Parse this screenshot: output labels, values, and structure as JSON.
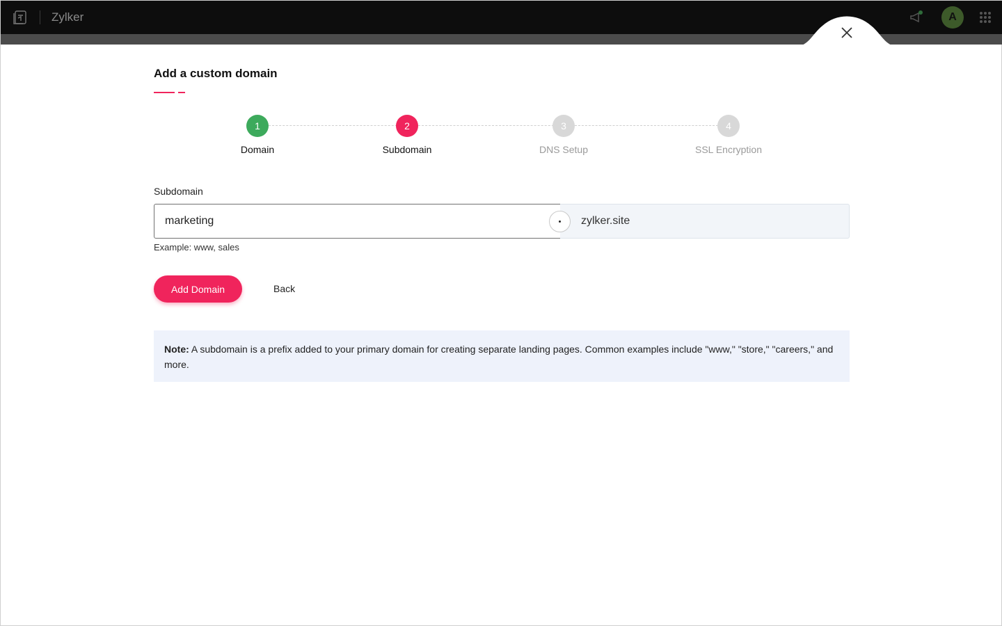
{
  "topbar": {
    "app_name": "Zylker",
    "avatar_initial": "A",
    "icons": [
      "app-logo-icon",
      "megaphone-icon",
      "apps-grid-icon"
    ]
  },
  "panel": {
    "title": "Add a custom domain",
    "close_icon": "close-icon"
  },
  "stepper": {
    "steps": [
      {
        "number": "1",
        "label": "Domain",
        "state": "completed"
      },
      {
        "number": "2",
        "label": "Subdomain",
        "state": "active"
      },
      {
        "number": "3",
        "label": "DNS Setup",
        "state": "pending"
      },
      {
        "number": "4",
        "label": "SSL Encryption",
        "state": "pending"
      }
    ]
  },
  "form": {
    "label": "Subdomain",
    "value": "marketing",
    "suffix": "zylker.site",
    "hint": "Example: www, sales"
  },
  "actions": {
    "primary_label": "Add Domain",
    "back_label": "Back"
  },
  "note": {
    "prefix": "Note:",
    "text": " A subdomain is a prefix added to your primary domain for creating separate landing pages. Common examples include \"www,\" \"store,\" \"careers,\" and more."
  },
  "colors": {
    "accent": "#f0245c",
    "completed": "#3daa5c",
    "pending": "#d8d8d8",
    "topbar": "#0d0d0d",
    "note_bg": "#eef2fb"
  }
}
